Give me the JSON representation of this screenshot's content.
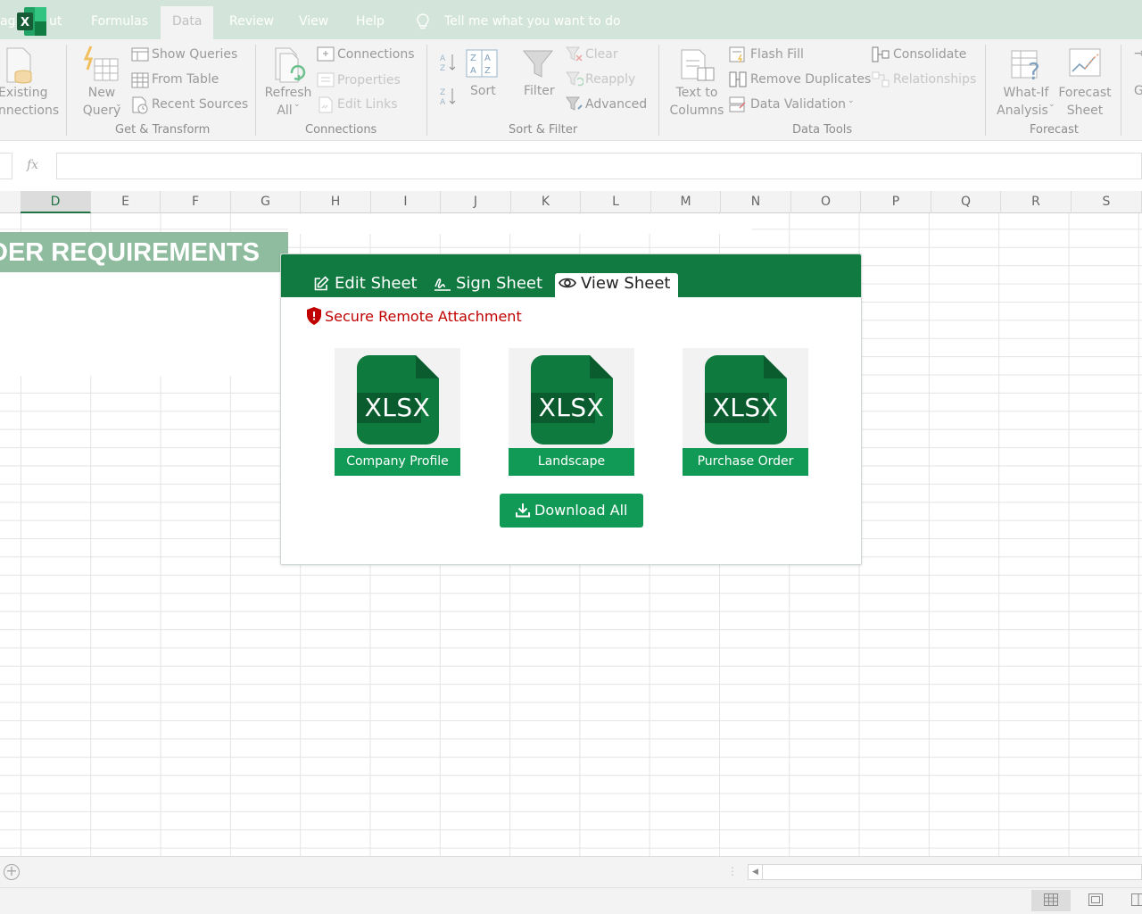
{
  "tabbar": {
    "tabs": [
      {
        "label": "ut"
      },
      {
        "label": "Formulas"
      },
      {
        "label": "Data"
      },
      {
        "label": "Review"
      },
      {
        "label": "View"
      },
      {
        "label": "Help"
      }
    ],
    "left_clip": "ag",
    "tell_me": "Tell me what you want to do"
  },
  "ribbon": {
    "get_transform": {
      "existing_line1": "Existing",
      "existing_line2": "nnections",
      "new_query_line1": "New",
      "new_query_line2": "Query",
      "show_queries": "Show Queries",
      "from_table": "From Table",
      "recent_sources": "Recent Sources",
      "label": "Get & Transform"
    },
    "connections": {
      "refresh_line1": "Refresh",
      "refresh_line2": "All",
      "connections": "Connections",
      "properties": "Properties",
      "edit_links": "Edit Links",
      "label": "Connections"
    },
    "sort_filter": {
      "sort": "Sort",
      "filter": "Filter",
      "clear": "Clear",
      "reapply": "Reapply",
      "advanced": "Advanced",
      "label": "Sort & Filter"
    },
    "data_tools": {
      "text_to_columns_line1": "Text to",
      "text_to_columns_line2": "Columns",
      "flash_fill": "Flash Fill",
      "remove_duplicates": "Remove Duplicates",
      "data_validation": "Data Validation",
      "consolidate": "Consolidate",
      "relationships": "Relationships",
      "label": "Data Tools"
    },
    "forecast": {
      "what_if_line1": "What-If",
      "what_if_line2": "Analysis",
      "forecast_sheet_line1": "Forecast",
      "forecast_sheet_line2": "Sheet",
      "label": "Forecast"
    },
    "clipped": "G"
  },
  "formula_bar": {
    "fx": "fx",
    "value": ""
  },
  "grid": {
    "columns": [
      "D",
      "E",
      "F",
      "G",
      "H",
      "I",
      "J",
      "K",
      "L",
      "M",
      "N",
      "O",
      "P",
      "Q",
      "R",
      "S"
    ],
    "selected_column": "D",
    "title_cell": "DER REQUIREMENTS"
  },
  "modal": {
    "tabs": [
      {
        "label": "Edit Sheet",
        "icon": "edit-icon"
      },
      {
        "label": "Sign Sheet",
        "icon": "signature-icon"
      },
      {
        "label": "View Sheet",
        "icon": "eye-icon",
        "active": true
      }
    ],
    "secure_label": "Secure Remote Attachment",
    "files": [
      {
        "ext": "XLSX",
        "name": "Company Profile"
      },
      {
        "ext": "XLSX",
        "name": "Landscape"
      },
      {
        "ext": "XLSX",
        "name": "Purchase Order"
      }
    ],
    "download_all": "Download All"
  },
  "colors": {
    "excel_green": "#217346",
    "modal_header": "#117a40",
    "button_green": "#119a55",
    "file_icon_green": "#0f7a3e",
    "secure_red": "#c00000",
    "title_band": "#8fbc9f"
  }
}
